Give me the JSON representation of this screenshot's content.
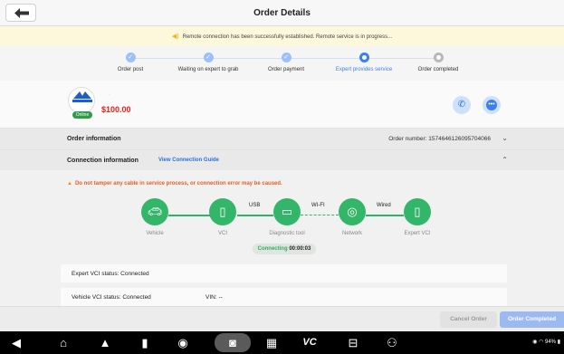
{
  "header": {
    "title": "Order Details",
    "back_icon": "back-arrow-icon"
  },
  "banner": {
    "icon": "speaker-icon",
    "text": "Remote connection has been successfully established. Remote service is in progress..."
  },
  "steps": [
    {
      "label": "Order post",
      "state": "done"
    },
    {
      "label": "Waiting on expert to grab",
      "state": "done"
    },
    {
      "label": "Order payment",
      "state": "done"
    },
    {
      "label": "Expert provides service",
      "state": "active"
    },
    {
      "label": "Order completed",
      "state": "pending"
    }
  ],
  "expert": {
    "badge": "Online",
    "price": "$100.00",
    "name_stub": "·"
  },
  "order_info": {
    "title": "Order information",
    "number": "Order number: 1574646126095704066"
  },
  "connection": {
    "title": "Connection information",
    "guide_link": "View Connection Guide",
    "warning": "Do not tamper any cable in service process, or connection error may be caused.",
    "nodes": [
      "Vehicle",
      "VCI",
      "Diagnostic tool",
      "Network",
      "Expert VCI"
    ],
    "links": [
      "USB",
      "WI-FI",
      "Wired"
    ],
    "connecting_label": "Connecting",
    "connecting_time": "00:00:03",
    "expert_vci_status": "Expert VCI status: Connected",
    "vehicle_vci_status": "Vehicle VCI status: Connected",
    "vin": "VIN: --"
  },
  "footer": {
    "cancel": "Cancel Order",
    "complete": "Order Completed"
  },
  "system_tray": {
    "battery": "94%",
    "icons": [
      "wifi-icon",
      "battery-icon"
    ]
  },
  "colors": {
    "accent": "#3c7ff0",
    "green": "#34b66a",
    "price": "#e0231a",
    "warning": "#e85d20"
  }
}
